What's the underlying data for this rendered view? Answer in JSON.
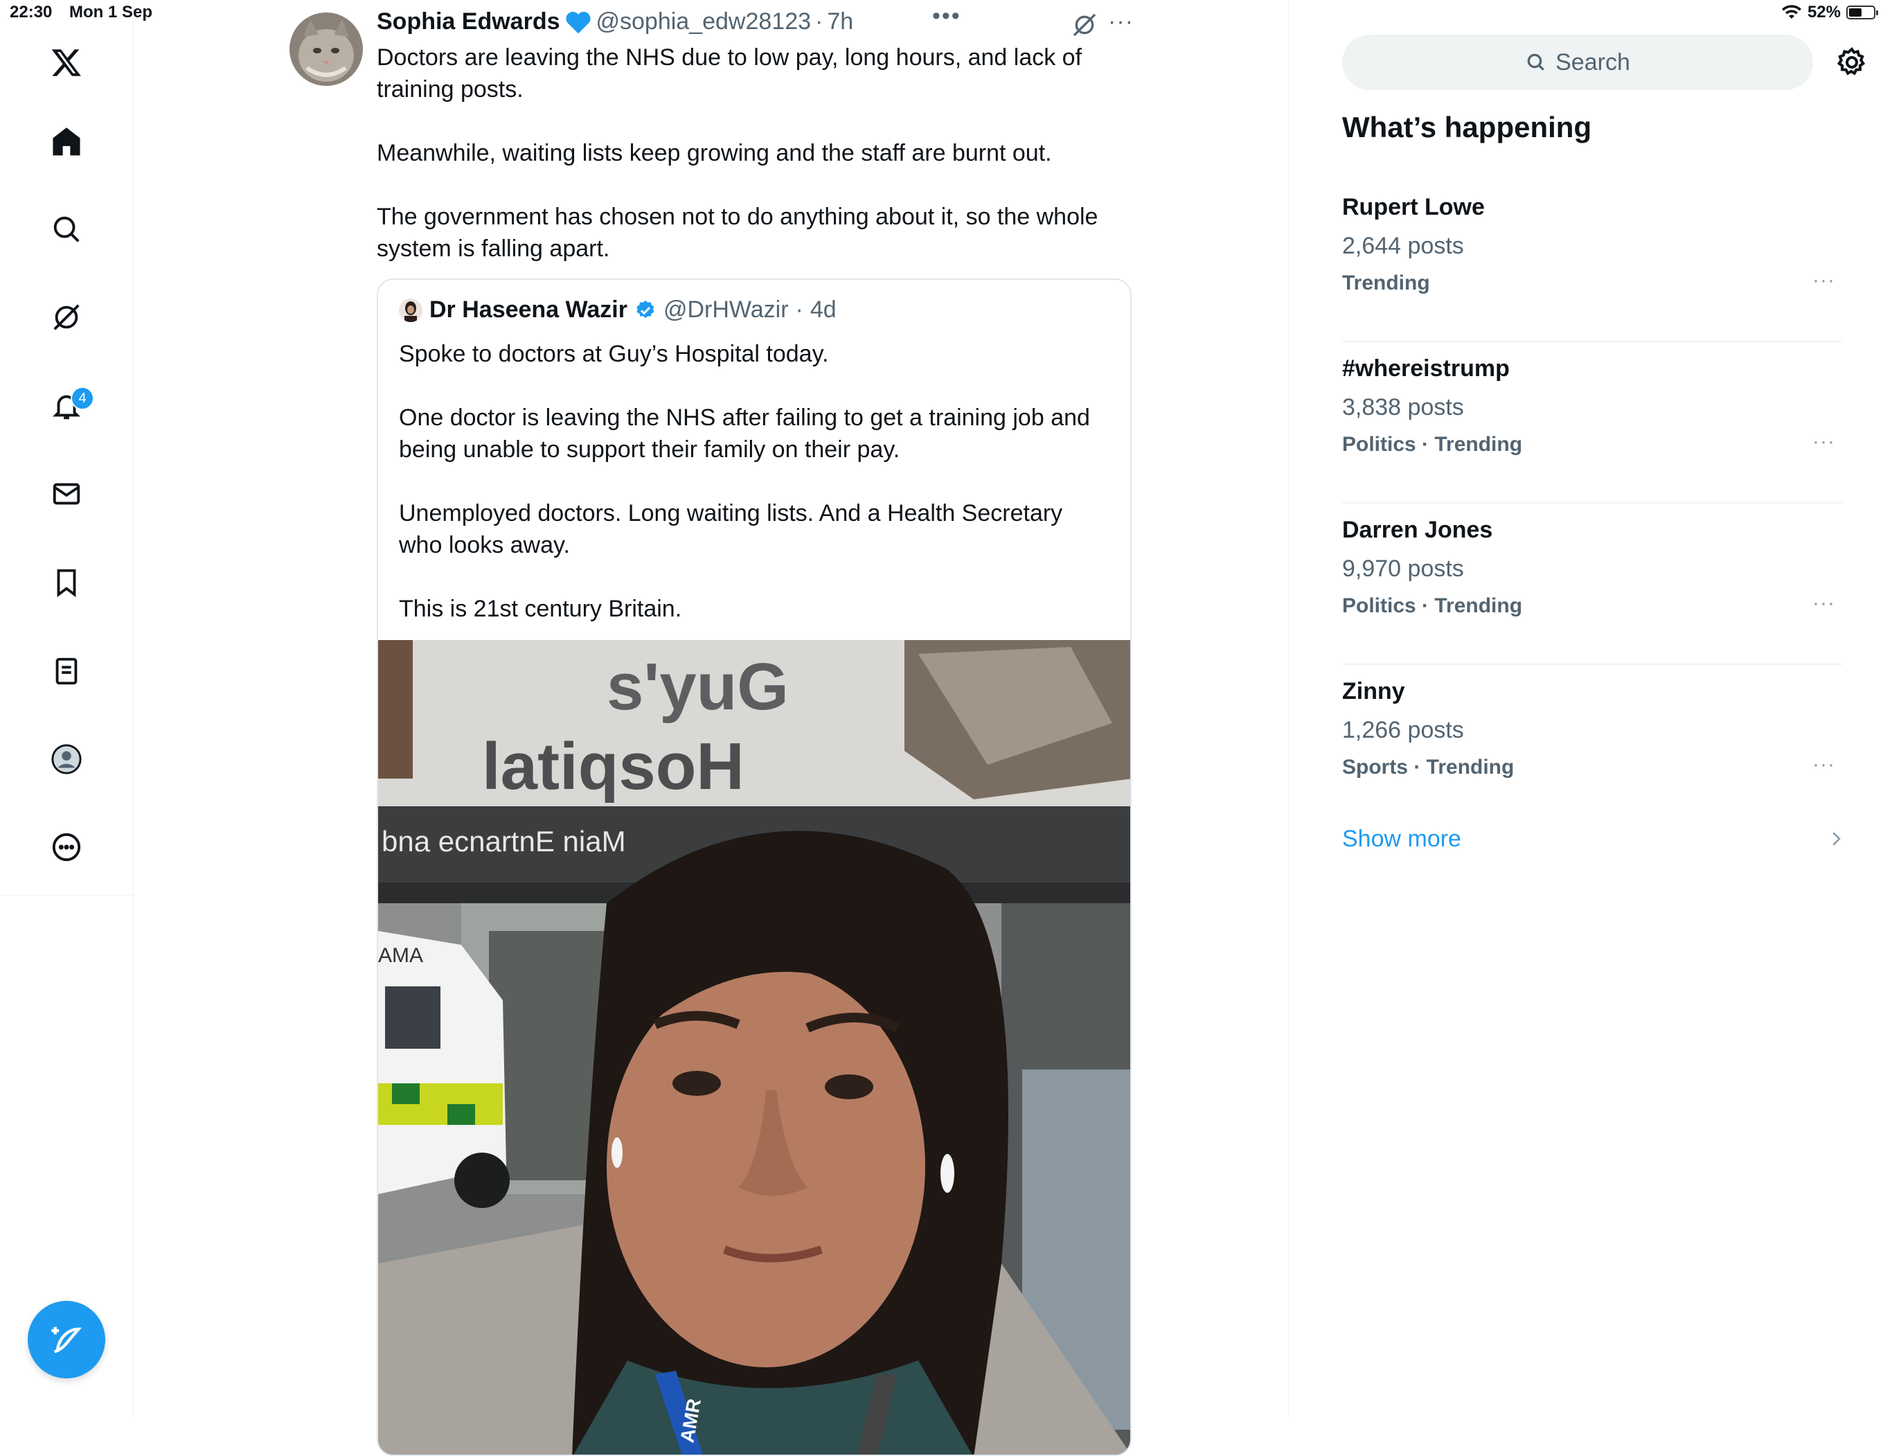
{
  "status_bar": {
    "time": "22:30",
    "date": "Mon 1 Sep",
    "battery": "52%",
    "battery_level": 0.52
  },
  "nav": {
    "items": [
      "home-icon",
      "search-icon",
      "grok-icon",
      "notifications-icon",
      "messages-icon",
      "bookmarks-icon",
      "lists-icon",
      "profile-icon",
      "more-icon"
    ],
    "notification_count": "4",
    "compose_icon": "compose-feather-icon"
  },
  "post": {
    "author_name": "Sophia Edwards",
    "handle": "@sophia_edw28123",
    "separator": "·",
    "time": "7h",
    "paragraphs": [
      "Doctors are leaving the NHS due to low pay, long hours, and lack of training posts.",
      "Meanwhile, waiting lists keep growing and the staff are burnt out.",
      "The government has chosen not to do anything about it, so the whole system is falling apart."
    ],
    "quoted": {
      "author_name": "Dr Haseena Wazir",
      "handle": "@DrHWazir",
      "separator": "·",
      "time": "4d",
      "paragraphs": [
        "Spoke to doctors at Guy’s Hospital today.",
        "One doctor is leaving the NHS after failing to get a training job and being unable to support their family on their pay.",
        "Unemployed doctors. Long waiting lists. And a Health Secretary who looks away.",
        "This is 21st century Britain."
      ],
      "image_sign": {
        "line1": "s'yuG",
        "line2": "latiqsoH",
        "line3": "bna ecnartnE niaM",
        "van_text": "AMA",
        "lanyard_text": "AMR"
      }
    }
  },
  "sidebar": {
    "search_placeholder": "Search",
    "section_title": "What’s happening",
    "trends": [
      {
        "name": "Rupert Lowe",
        "count": "2,644 posts",
        "meta": "Trending"
      },
      {
        "name": "#whereistrump",
        "count": "3,838 posts",
        "meta": "Politics · Trending"
      },
      {
        "name": "Darren Jones",
        "count": "9,970 posts",
        "meta": "Politics · Trending"
      },
      {
        "name": "Zinny",
        "count": "1,266 posts",
        "meta": "Sports · Trending"
      }
    ],
    "show_more": "Show more"
  },
  "colors": {
    "accent": "#1d9bf0",
    "text": "#0f1419",
    "muted": "#536471",
    "divider": "#eff3f4"
  }
}
